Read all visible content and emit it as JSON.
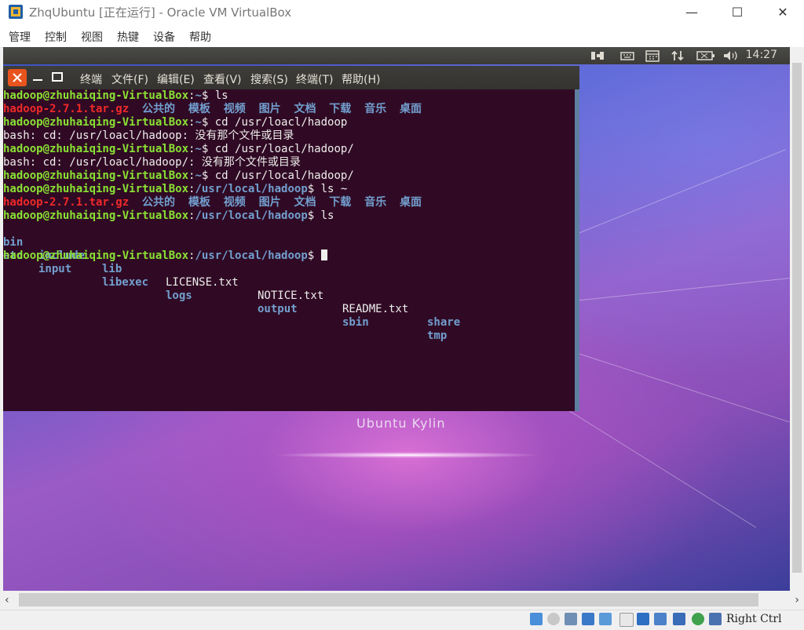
{
  "window": {
    "title": "ZhqUbuntu [正在运行] - Oracle VM VirtualBox",
    "minimize": "—",
    "maximize": "☐",
    "close": "✕"
  },
  "menubar": {
    "items": [
      "管理",
      "控制",
      "视图",
      "热键",
      "设备",
      "帮助"
    ]
  },
  "guest_topbar": {
    "clock": "14:27"
  },
  "desktop": {
    "label": "Ubuntu Kylin"
  },
  "terminal": {
    "menu": [
      "终端",
      "文件(F)",
      "编辑(E)",
      "查看(V)",
      "搜索(S)",
      "终端(T)",
      "帮助(H)"
    ],
    "lines": [
      {
        "prompt": "hadoop@zhuhaiqing-VirtualBox",
        "path": "~",
        "cmd": "$ ls"
      },
      {
        "file": "hadoop-2.7.1.tar.gz",
        "dirs": "公共的  模板  视频  图片  文档  下载  音乐  桌面"
      },
      {
        "prompt": "hadoop@zhuhaiqing-VirtualBox",
        "path": "~",
        "cmd": "$ cd /usr/loacl/hadoop"
      },
      {
        "text": "bash: cd: /usr/loacl/hadoop: 没有那个文件或目录"
      },
      {
        "prompt": "hadoop@zhuhaiqing-VirtualBox",
        "path": "~",
        "cmd": "$ cd /usr/loacl/hadoop/"
      },
      {
        "text": "bash: cd: /usr/loacl/hadoop/: 没有那个文件或目录"
      },
      {
        "prompt": "hadoop@zhuhaiqing-VirtualBox",
        "path": "~",
        "cmd": "$ cd /usr/local/hadoop/"
      },
      {
        "prompt": "hadoop@zhuhaiqing-VirtualBox",
        "path": "/usr/local/hadoop",
        "cmd": "$ ls ~"
      },
      {
        "file": "hadoop-2.7.1.tar.gz",
        "dirs": "公共的  模板  视频  图片  文档  下载  音乐  桌面"
      },
      {
        "prompt": "hadoop@zhuhaiqing-VirtualBox",
        "path": "/usr/local/hadoop",
        "cmd": "$ ls"
      },
      {
        "cols": [
          "bin",
          "include",
          "lib",
          "LICENSE.txt",
          "NOTICE.txt",
          "README.txt",
          "share"
        ]
      },
      {
        "cols": [
          "etc",
          "input",
          "libexec",
          "logs",
          "output",
          "sbin",
          "tmp"
        ]
      },
      {
        "prompt": "hadoop@zhuhaiqing-VirtualBox",
        "path": "/usr/local/hadoop",
        "cmd": "$ "
      }
    ]
  },
  "status": {
    "host_key": "Right Ctrl"
  },
  "colors": {
    "terminal_bg": "#300a24",
    "prompt": "#8ae234",
    "dir": "#729fcf",
    "archive": "#ef2929",
    "close_button": "#e8541e"
  }
}
